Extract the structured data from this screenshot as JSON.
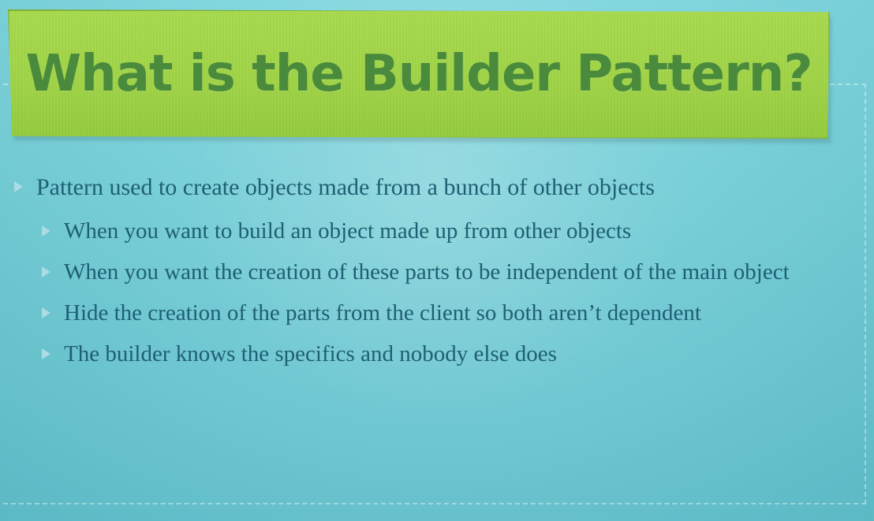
{
  "slide": {
    "title": "What is the Builder Pattern?",
    "bullets": [
      {
        "text": "Pattern used to create objects made from a bunch of other objects"
      },
      {
        "text": "When you want to build an object made up from other objects"
      },
      {
        "text": "When you want the creation of these parts to be independent of the main object"
      },
      {
        "text": "Hide the creation of the parts from the client so both aren’t dependent"
      },
      {
        "text": "The builder knows the specifics and nobody else does"
      }
    ]
  }
}
